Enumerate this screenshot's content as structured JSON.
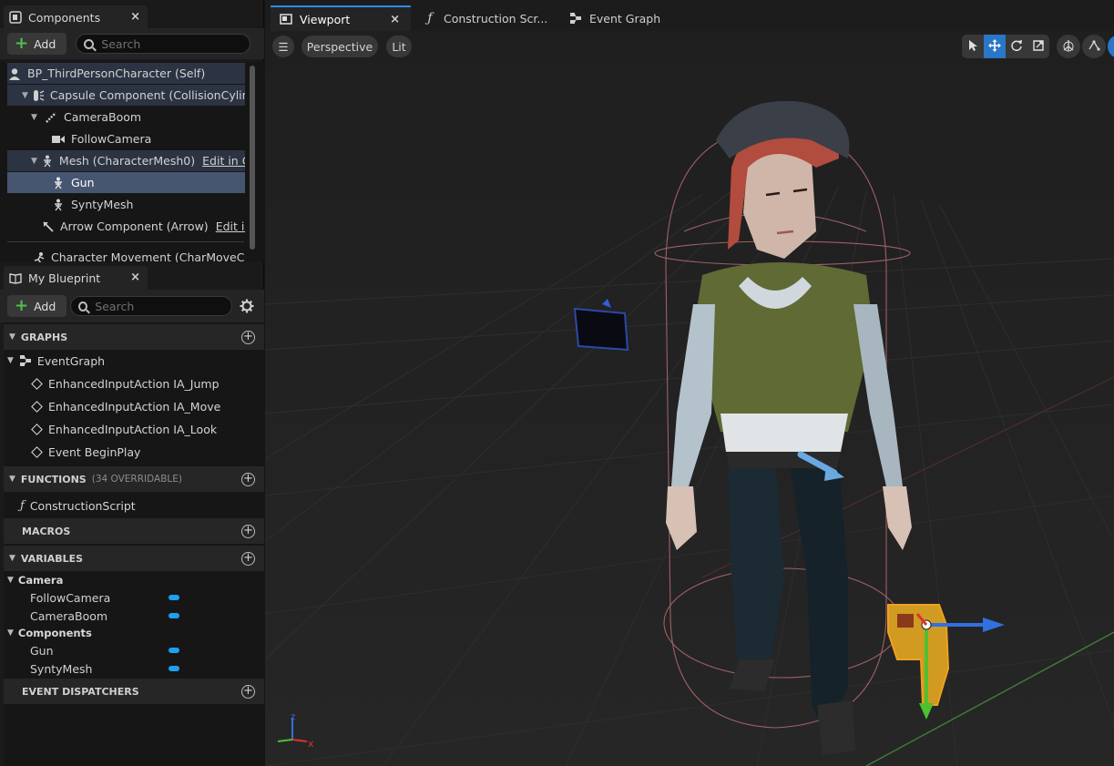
{
  "components_panel": {
    "tab_label": "Components",
    "close_glyph": "×",
    "add_label": "Add",
    "search_placeholder": "Search",
    "tree": [
      {
        "label": "BP_ThirdPersonCharacter (Self)",
        "icon": "person-icon"
      },
      {
        "label": "Capsule Component (CollisionCylinder)",
        "icon": "capsule-icon"
      },
      {
        "label": "CameraBoom",
        "icon": "spring-arm-icon"
      },
      {
        "label": "FollowCamera",
        "icon": "camera-icon"
      },
      {
        "label": "Mesh (CharacterMesh0)",
        "icon": "skeleton-icon",
        "edit": "Edit in C++"
      },
      {
        "label": "Gun",
        "icon": "skeleton-icon"
      },
      {
        "label": "SyntyMesh",
        "icon": "skeleton-icon"
      },
      {
        "label": "Arrow Component (Arrow)",
        "icon": "arrow-icon",
        "edit": "Edit in C++"
      },
      {
        "label": "Character Movement (CharMoveComp)",
        "icon": "movement-icon"
      }
    ]
  },
  "my_blueprint_panel": {
    "tab_label": "My Blueprint",
    "close_glyph": "×",
    "add_label": "Add",
    "search_placeholder": "Search",
    "graphs_header": "GRAPHS",
    "event_graph": "EventGraph",
    "events": [
      "EnhancedInputAction IA_Jump",
      "EnhancedInputAction IA_Move",
      "EnhancedInputAction IA_Look",
      "Event BeginPlay"
    ],
    "functions_header": "FUNCTIONS",
    "functions_sub": "(34 OVERRIDABLE)",
    "construction_script": "ConstructionScript",
    "macros_header": "MACROS",
    "variables_header": "VARIABLES",
    "variable_categories": [
      {
        "name": "Camera",
        "vars": [
          "FollowCamera",
          "CameraBoom"
        ]
      },
      {
        "name": "Components",
        "vars": [
          "Gun",
          "SyntyMesh"
        ]
      }
    ],
    "dispatchers_header": "EVENT DISPATCHERS",
    "var_color": "#1ea0f0"
  },
  "doc_tabs": [
    {
      "label": "Viewport",
      "icon": "viewport-icon",
      "active": true
    },
    {
      "label": "Construction Scr...",
      "icon": "function-icon",
      "active": false
    },
    {
      "label": "Event Graph",
      "icon": "graph-icon",
      "active": false
    }
  ],
  "viewport": {
    "menu_glyph": "☰",
    "view_mode": "Perspective",
    "lighting": "Lit",
    "tools": [
      "select-icon",
      "translate-icon",
      "rotate-icon",
      "scale-icon"
    ],
    "active_tool": "translate-icon",
    "axis_labels": {
      "x": "x",
      "z": "z"
    },
    "colors": {
      "accent": "#2a76c8",
      "x_axis": "#e03030",
      "y_axis": "#4fc030",
      "z_axis": "#3070e0"
    }
  }
}
